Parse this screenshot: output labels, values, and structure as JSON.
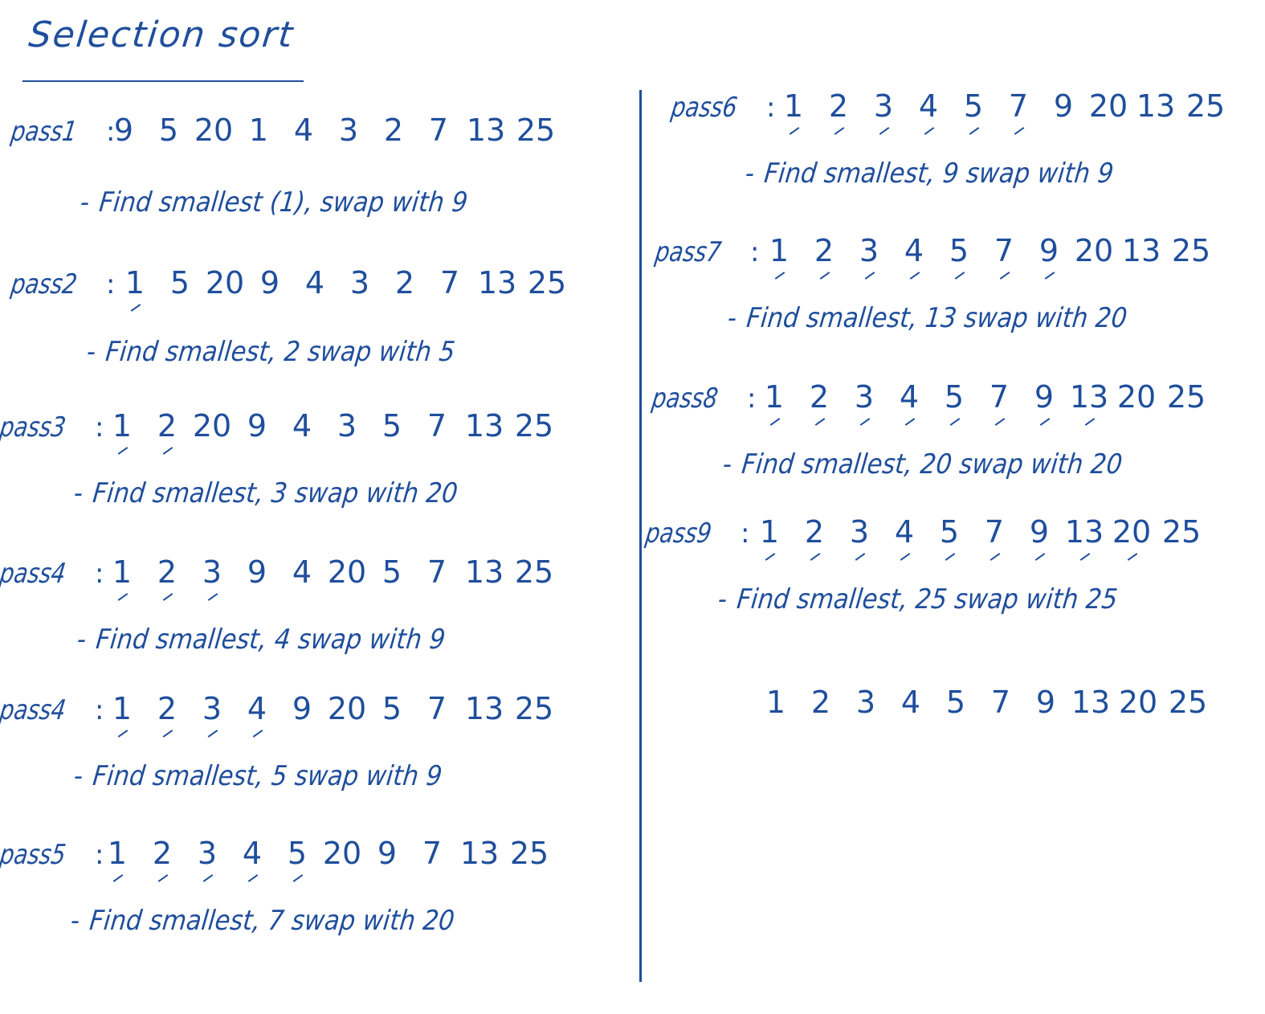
{
  "title": "Selection sort",
  "passes": [
    {
      "label": "pass1",
      "numbers": [
        "9",
        "5",
        "20",
        "1",
        "4",
        "3",
        "2",
        "7",
        "13",
        "25"
      ],
      "sorted_count": 0,
      "step": "Find smallest (1), swap with 9"
    },
    {
      "label": "pass2",
      "numbers": [
        "1",
        "5",
        "20",
        "9",
        "4",
        "3",
        "2",
        "7",
        "13",
        "25"
      ],
      "sorted_count": 1,
      "step": "Find smallest, 2 swap with 5"
    },
    {
      "label": "pass3",
      "numbers": [
        "1",
        "2",
        "20",
        "9",
        "4",
        "3",
        "5",
        "7",
        "13",
        "25"
      ],
      "sorted_count": 2,
      "step": "Find smallest, 3 swap with 20"
    },
    {
      "label": "pass4",
      "numbers": [
        "1",
        "2",
        "3",
        "9",
        "4",
        "20",
        "5",
        "7",
        "13",
        "25"
      ],
      "sorted_count": 3,
      "step": "Find smallest, 4 swap with 9"
    },
    {
      "label": "pass4",
      "numbers": [
        "1",
        "2",
        "3",
        "4",
        "9",
        "20",
        "5",
        "7",
        "13",
        "25"
      ],
      "sorted_count": 4,
      "step": "Find smallest, 5 swap with 9"
    },
    {
      "label": "pass5",
      "numbers": [
        "1",
        "2",
        "3",
        "4",
        "5",
        "20",
        "9",
        "7",
        "13",
        "25"
      ],
      "sorted_count": 5,
      "step": "Find smallest, 7 swap with 20"
    },
    {
      "label": "pass6",
      "numbers": [
        "1",
        "2",
        "3",
        "4",
        "5",
        "7",
        "9",
        "20",
        "13",
        "25"
      ],
      "sorted_count": 6,
      "step": "Find smallest, 9 swap with 9"
    },
    {
      "label": "pass7",
      "numbers": [
        "1",
        "2",
        "3",
        "4",
        "5",
        "7",
        "9",
        "20",
        "13",
        "25"
      ],
      "sorted_count": 7,
      "step": "Find smallest, 13 swap with 20"
    },
    {
      "label": "pass8",
      "numbers": [
        "1",
        "2",
        "3",
        "4",
        "5",
        "7",
        "9",
        "13",
        "20",
        "25"
      ],
      "sorted_count": 8,
      "step": "Find smallest, 20 swap with 20"
    },
    {
      "label": "pass9",
      "numbers": [
        "1",
        "2",
        "3",
        "4",
        "5",
        "7",
        "9",
        "13",
        "20",
        "25"
      ],
      "sorted_count": 9,
      "step": "Find smallest, 25 swap with 25"
    }
  ],
  "final": [
    "1",
    "2",
    "3",
    "4",
    "5",
    "7",
    "9",
    "13",
    "20",
    "25"
  ],
  "ink_color": "#1f4e9c"
}
